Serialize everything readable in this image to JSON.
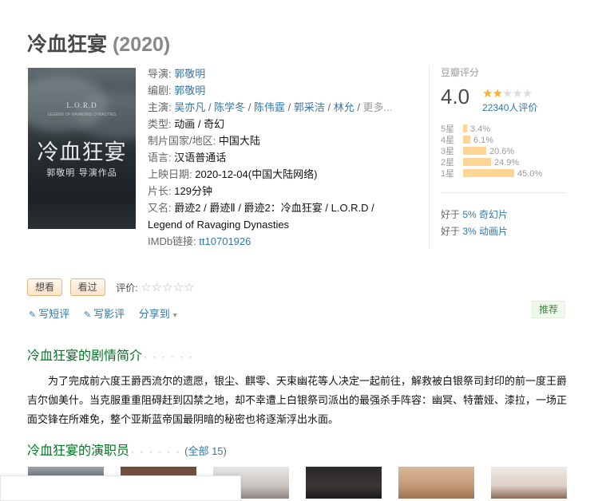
{
  "movie": {
    "title": "冷血狂宴",
    "year": "(2020)"
  },
  "poster": {
    "lord": "L.O.R.D",
    "subtitle": "LEGEND OF RAVAGING DYNASTIES",
    "title": "冷血狂宴",
    "director_line": "郭敬明 导演作品"
  },
  "info": {
    "director_label": "导演:",
    "director": "郭敬明",
    "writer_label": "编剧:",
    "writer": "郭敬明",
    "cast_label": "主演:",
    "cast": [
      "吴亦凡",
      "陈学冬",
      "陈伟霆",
      "郭采洁",
      "林允"
    ],
    "cast_more": "更多...",
    "genre_label": "类型:",
    "genre": "动画 / 奇幻",
    "country_label": "制片国家/地区:",
    "country": "中国大陆",
    "language_label": "语言:",
    "language": "汉语普通话",
    "release_label": "上映日期:",
    "release": "2020-12-04(中国大陆网络)",
    "runtime_label": "片长:",
    "runtime": "129分钟",
    "aka_label": "又名:",
    "aka_line1": "爵迹2 / 爵迹Ⅱ / 爵迹2：冷血狂宴 / L.O.R.D /",
    "aka_line2": "Legend of Ravaging Dynasties",
    "imdb_label": "IMDb链接:",
    "imdb": "tt10701926"
  },
  "rating": {
    "label": "豆瓣评分",
    "score": "4.0",
    "stars_filled": 2,
    "stars_total": 5,
    "votes": "22340人评价",
    "bars": [
      {
        "label": "5星",
        "pct": "3.4%",
        "value": 3.4
      },
      {
        "label": "4星",
        "pct": "6.1%",
        "value": 6.1
      },
      {
        "label": "3星",
        "pct": "20.6%",
        "value": 20.6
      },
      {
        "label": "2星",
        "pct": "24.9%",
        "value": 24.9
      },
      {
        "label": "1星",
        "pct": "45.0%",
        "value": 45.0
      }
    ],
    "better_than": [
      {
        "prefix": "好于",
        "link": "5% 奇幻片"
      },
      {
        "prefix": "好于",
        "link": "3% 动画片"
      }
    ]
  },
  "actions": {
    "want": "想看",
    "seen": "看过",
    "rate_label": "评价:",
    "rate_stars": "☆☆☆☆☆",
    "short_review": "写短评",
    "review": "写影评",
    "share": "分享到",
    "recommend": "推荐"
  },
  "synopsis": {
    "heading": "冷血狂宴的剧情简介",
    "dots": "· · · · · ·",
    "text": "为了完成前六度王爵西流尔的遗愿，银尘、麒零、天束幽花等人决定一起前往，解救被白银祭司封印的前一度王爵吉尔伽美什。当克服重重阻碍赶到囚禁之地，却不幸遭上白银祭司派出的最强杀手阵容：幽冥、特蕾娅、漆拉，一场正面交锋在所难免，整个亚斯蓝帝国最阴暗的秘密也将逐渐浮出水面。"
  },
  "cast_section": {
    "heading": "冷血狂宴的演职员",
    "dots": "· · · · · ·",
    "open_paren": "(",
    "all_link": "全部 15",
    "close_paren": ")"
  },
  "icons": {
    "pencil": "✎",
    "caret": "▼"
  },
  "colors": {
    "link": "#3377aa",
    "green_heading": "#007722",
    "star": "#ffac2d",
    "bar": "#ffd596"
  }
}
